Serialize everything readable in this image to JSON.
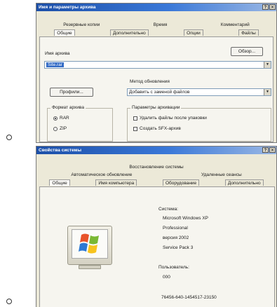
{
  "bullets": [
    "",
    ""
  ],
  "archive_dialog": {
    "title": "Имя и параметры архива",
    "help": "?",
    "close": "✕",
    "tabs_back": [
      "Резервные копии",
      "Время",
      "Комментарий"
    ],
    "tabs_front": [
      "Общие",
      "Дополнительно",
      "Опции",
      "Файлы"
    ],
    "archive_name_label": "Имя архива",
    "browse_button": "Обзор...",
    "archive_name_value": "Site.rar",
    "update_method_label": "Метод обновления",
    "profiles_button": "Профили...",
    "update_method_value": "Добавить с заменой файлов",
    "format_group": "Формат архива",
    "format_options": [
      "RAR",
      "ZIP"
    ],
    "params_group": "Параметры архивации",
    "param_options": [
      "Удалить файлы после упаковки",
      "Создать SFX-архив"
    ]
  },
  "system_dialog": {
    "title": "Свойства системы",
    "help": "?",
    "close": "✕",
    "tabs_row1": [
      "Восстановление системы"
    ],
    "tabs_row2": [
      "Автоматическое обновление",
      "Удаленные сеансы"
    ],
    "tabs_row3": [
      "Общие",
      "Имя компьютера",
      "Оборудование",
      "Дополнительно"
    ],
    "system_label": "Система:",
    "system_lines": [
      "Microsoft Windows XP",
      "Professional",
      "версия 2002",
      "Service Pack 3"
    ],
    "user_label": "Пользователь:",
    "user_value": "000",
    "serial": "76456-640-1454517-23150"
  }
}
